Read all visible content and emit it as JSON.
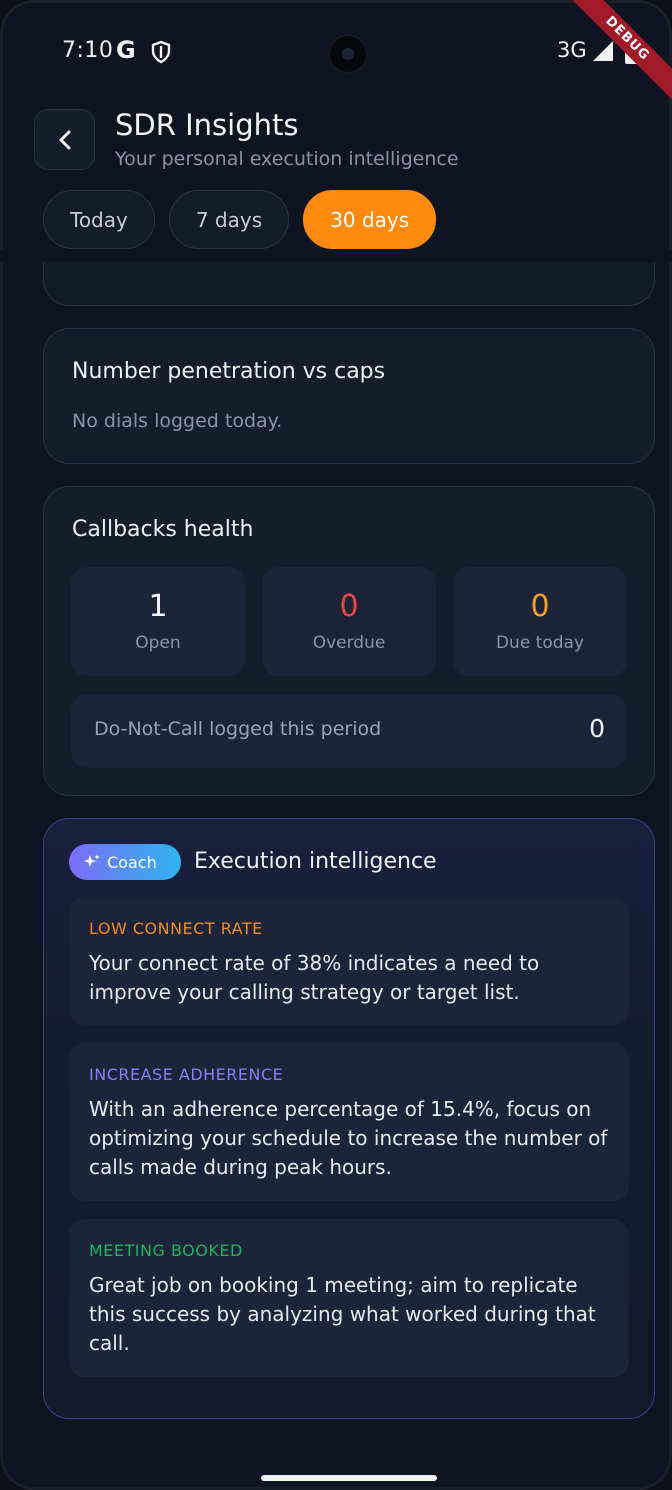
{
  "status_bar": {
    "time": "7:10",
    "google": "G",
    "network": "3G",
    "debug": "DEBUG"
  },
  "header": {
    "title": "SDR Insights",
    "subtitle": "Your personal execution intelligence"
  },
  "tabs": [
    {
      "label": "Today",
      "active": false
    },
    {
      "label": "7 days",
      "active": false
    },
    {
      "label": "30 days",
      "active": true
    }
  ],
  "penetration": {
    "title": "Number penetration vs caps",
    "empty_text": "No dials logged today."
  },
  "callbacks": {
    "title": "Callbacks health",
    "stats": [
      {
        "value": "1",
        "label": "Open",
        "color": "#f3f5f9"
      },
      {
        "value": "0",
        "label": "Overdue",
        "color": "#ef4444"
      },
      {
        "value": "0",
        "label": "Due today",
        "color": "#f59e2b"
      }
    ],
    "dnc_label": "Do-Not-Call logged this period",
    "dnc_value": "0"
  },
  "coach": {
    "badge": "Coach",
    "title": "Execution intelligence",
    "insights": [
      {
        "tag": "LOW CONNECT RATE",
        "color": "#f08a24",
        "text": "Your connect rate of 38% indicates a need to improve your calling strategy or target list."
      },
      {
        "tag": "INCREASE ADHERENCE",
        "color": "#8b7cf6",
        "text": "With an adherence percentage of 15.4%, focus on optimizing your schedule to increase the number of calls made during peak hours."
      },
      {
        "tag": "MEETING BOOKED",
        "color": "#22b35e",
        "text": "Great job on booking 1 meeting; aim to replicate this success by analyzing what worked during that call."
      }
    ]
  }
}
